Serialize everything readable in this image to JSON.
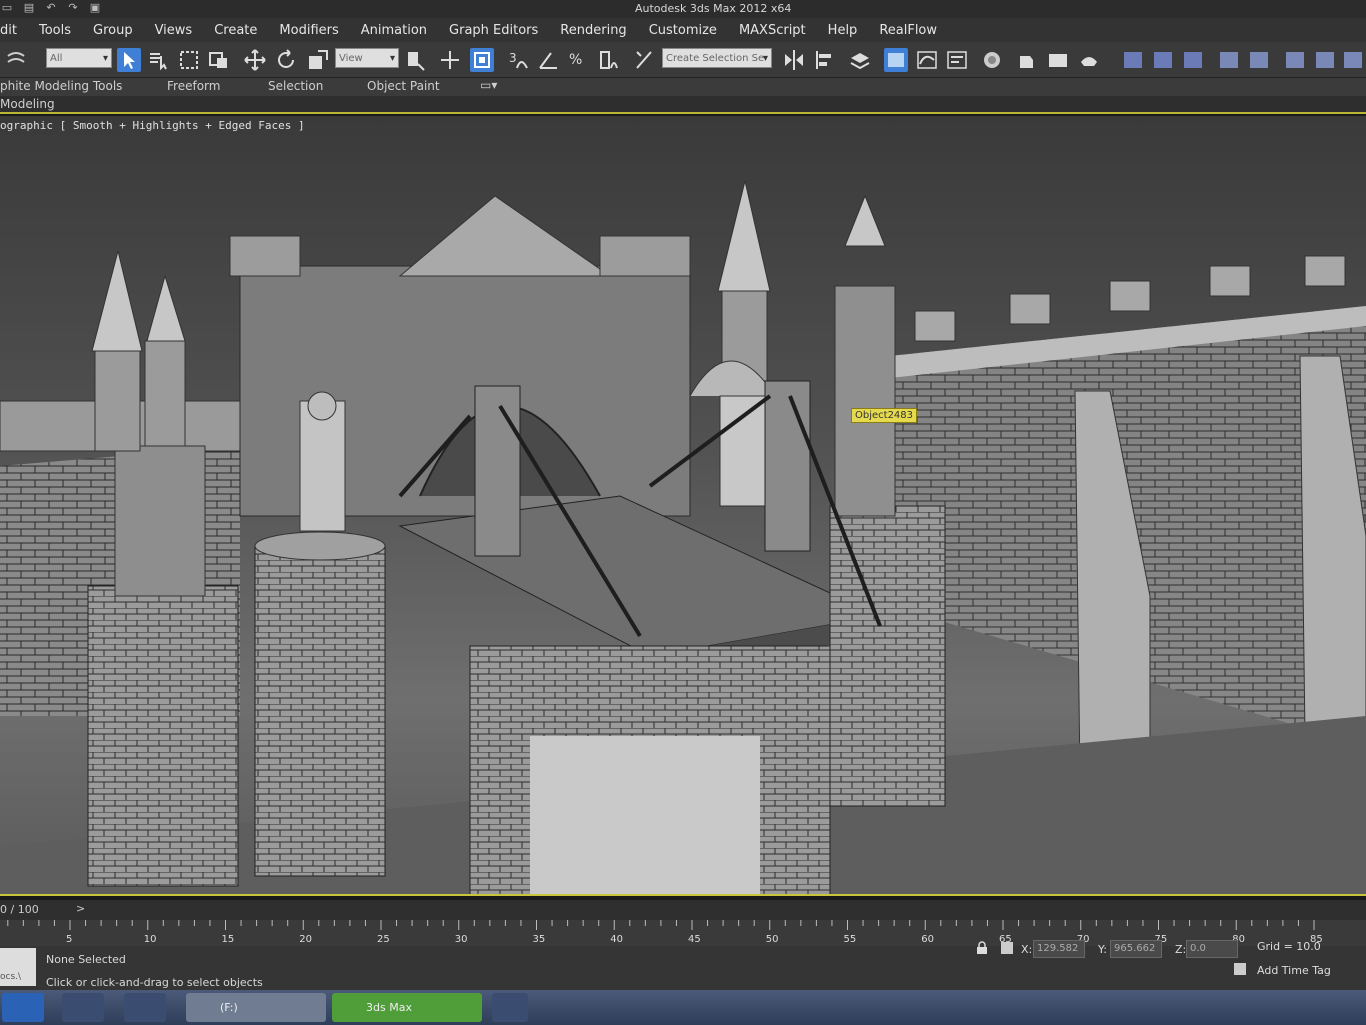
{
  "title_bar": {
    "title": "Autodesk 3ds Max 2012 x64"
  },
  "menu": [
    "dit",
    "Tools",
    "Group",
    "Views",
    "Create",
    "Modifiers",
    "Animation",
    "Graph Editors",
    "Rendering",
    "Customize",
    "MAXScript",
    "Help",
    "RealFlow"
  ],
  "toolbar": {
    "filter_value": "All",
    "ref_coord_value": "View",
    "selection_set_placeholder": "Create Selection Se"
  },
  "ribbon": {
    "tabs": [
      "phite Modeling Tools",
      "Freeform",
      "Selection",
      "Object Paint"
    ],
    "sub_label": "Modeling"
  },
  "viewport": {
    "label": "ographic [ Smooth + Highlights + Edged Faces ]",
    "tooltip": "Object2483"
  },
  "timeline": {
    "frame_counter": "0 / 100",
    "next_button": ">",
    "ticks": [
      "5",
      "10",
      "15",
      "20",
      "25",
      "30",
      "35",
      "40",
      "45",
      "50",
      "55",
      "60",
      "65",
      "70",
      "75",
      "80",
      "85"
    ]
  },
  "status": {
    "selection": "None Selected",
    "prompt": "Click or click-and-drag to select objects",
    "mini_label": "ocs.\\",
    "x_label": "X:",
    "x_value": "129.582",
    "y_label": "Y:",
    "y_value": "965.662",
    "z_label": "Z:",
    "z_value": "0.0",
    "grid": "Grid = 10.0",
    "add_time_tag": "Add Time Tag"
  },
  "taskbar": {
    "tasks": [
      {
        "label": ""
      },
      {
        "label": ""
      },
      {
        "label": ""
      },
      {
        "label": "(F:)"
      },
      {
        "label": "3ds Max"
      },
      {
        "label": ""
      }
    ]
  },
  "colors": {
    "accent": "#3f7fd6",
    "highlight_line": "#c9c43a",
    "tooltip_bg": "#e5d94e"
  }
}
